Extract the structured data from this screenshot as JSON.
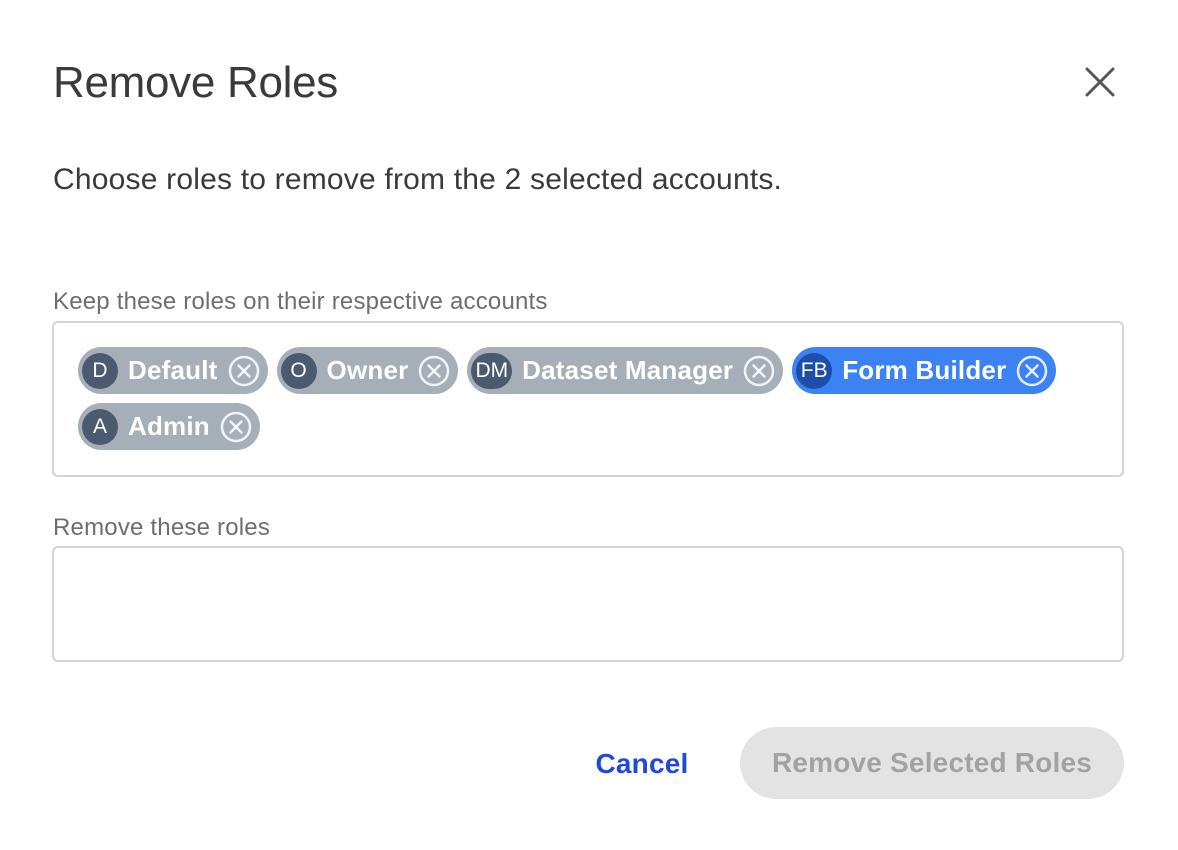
{
  "dialog": {
    "title": "Remove Roles",
    "subtitle": "Choose roles to remove from the 2 selected accounts."
  },
  "keep_section": {
    "label": "Keep these roles on their respective accounts",
    "roles": [
      {
        "initials": "D",
        "name": "Default",
        "selected": false
      },
      {
        "initials": "O",
        "name": "Owner",
        "selected": false
      },
      {
        "initials": "DM",
        "name": "Dataset Manager",
        "selected": false
      },
      {
        "initials": "FB",
        "name": "Form Builder",
        "selected": true
      },
      {
        "initials": "A",
        "name": "Admin",
        "selected": false
      }
    ]
  },
  "remove_section": {
    "label": "Remove these roles",
    "roles": []
  },
  "actions": {
    "cancel_label": "Cancel",
    "submit_label": "Remove Selected Roles",
    "submit_disabled": true
  },
  "icons": {
    "close": "close-icon",
    "chip_remove": "circle-x-icon"
  },
  "colors": {
    "chip_default": "#a6aeb8",
    "chip_selected": "#3c82f2",
    "avatar_default": "#4c5a6f",
    "avatar_selected": "#1e4fa8",
    "link": "#1f4ad9",
    "disabled_bg": "#e3e3e3",
    "disabled_text": "#a2a2a2"
  }
}
